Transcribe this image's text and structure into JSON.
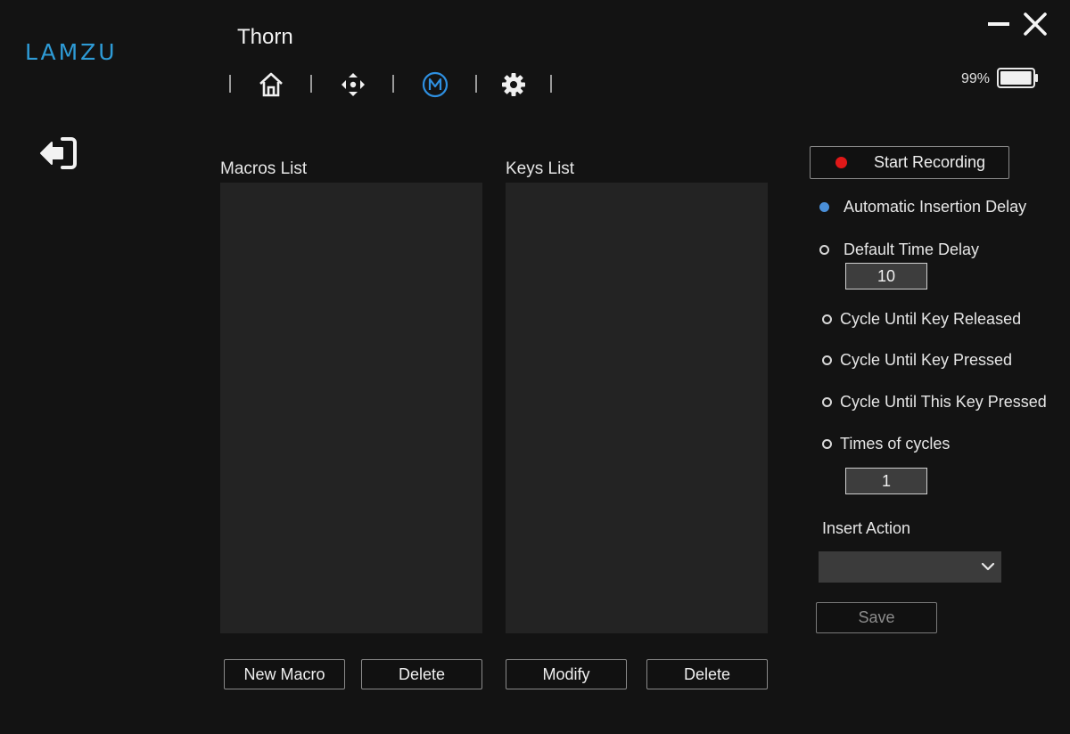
{
  "app": {
    "brand": "LAMZU",
    "device_name": "Thorn",
    "battery_percent": "99%",
    "battery_level": 0.99,
    "accent_color": "#2e9bd6"
  },
  "nav": {
    "items": [
      {
        "icon": "home-icon",
        "active": false
      },
      {
        "icon": "move-arrows-icon",
        "active": false
      },
      {
        "icon": "macro-m-icon",
        "active": true
      },
      {
        "icon": "gear-icon",
        "active": false
      }
    ]
  },
  "window": {
    "minimize_icon": "minimize-icon",
    "close_icon": "close-icon"
  },
  "macros": {
    "title": "Macros List",
    "items": [],
    "new_label": "New Macro",
    "delete_label": "Delete"
  },
  "keys": {
    "title": "Keys List",
    "items": [],
    "modify_label": "Modify",
    "delete_label": "Delete"
  },
  "settings": {
    "record_label": "Start Recording",
    "record_dot_color": "#e01818",
    "auto_delay_label": "Automatic Insertion Delay",
    "auto_delay_selected": true,
    "default_delay_label": "Default Time Delay",
    "default_delay_value": "10",
    "cycle_released_label": "Cycle Until Key Released",
    "cycle_pressed_label": "Cycle Until Key Pressed",
    "cycle_this_key_label": "Cycle Until This Key Pressed",
    "times_cycles_label": "Times of cycles",
    "times_cycles_value": "1",
    "insert_action_label": "Insert Action",
    "insert_action_value": "",
    "save_label": "Save"
  }
}
